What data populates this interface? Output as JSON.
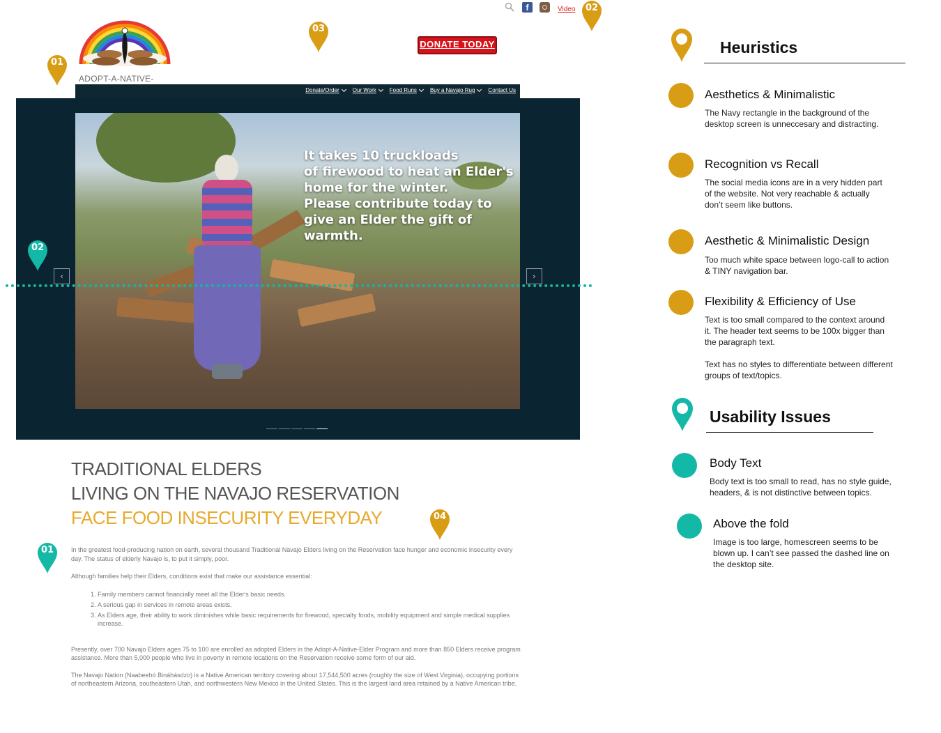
{
  "site": {
    "logo_caption": "ADOPT-A-NATIVE-ELDER",
    "video_link": "Video",
    "donate_button": "DONATE TODAY",
    "top_icons": [
      "search-icon",
      "facebook-icon",
      "instagram-icon"
    ],
    "nav": [
      {
        "label": "Donate/Order"
      },
      {
        "label": "Our Work"
      },
      {
        "label": "Food Runs"
      },
      {
        "label": "Buy a Navajo Rug"
      },
      {
        "label": "Contact Us"
      }
    ],
    "hero_text": "It takes 10 truckloads\nof firewood to heat an Elder's\nhome for the winter.\nPlease contribute today to\ngive an Elder the gift of warmth.",
    "carousel_prev": "‹",
    "carousel_next": "›",
    "headline": [
      "TRADITIONAL ELDERS",
      "LIVING ON THE NAVAJO RESERVATION",
      "FACE FOOD INSECURITY EVERYDAY"
    ],
    "para1": "In the greatest food-producing nation on earth, several thousand Traditional Navajo Elders living on the Reservation face hunger and economic insecurity every day. The status of elderly Navajo is, to put it simply, poor.",
    "para2": "Although families help their Elders, conditions exist that make our assistance essential:",
    "list": [
      "Family members cannot financially meet all the Elder's basic needs.",
      "A serious gap in services in remote areas exists.",
      "As Elders age, their ability to work diminishes while basic requirements for firewood, specialty foods, mobility equipment and simple medical supplies increase."
    ],
    "para3": "Presently, over 700 Navajo Elders ages 75 to 100 are enrolled as adopted Elders in the Adopt-A-Native-Elder Program and more than 850 Elders receive program assistance. More than 5,000 people who live in poverty in remote locations on the Reservation receive some form of our aid.",
    "para4": "The Navajo Nation (Naabeehó Bináhásdzo) is a Native American territory covering about 17,544,500 acres (roughly the size of West Virginia), occupying portions of northeastern Arizona, southeastern Utah, and northwestern New Mexico in the United States. This is the largest land area retained by a Native American tribe."
  },
  "pins": {
    "gold": [
      "01",
      "02",
      "03",
      "04"
    ],
    "teal": [
      "02",
      "01"
    ]
  },
  "colors": {
    "gold": "#d89d14",
    "teal": "#14b8a6",
    "navy": "#0b2431",
    "donate_red": "#d4131a"
  },
  "heuristics": {
    "title": "Heuristics",
    "items": [
      {
        "title": "Aesthetics & Minimalistic",
        "desc": "The Navy rectangle in the background of the desktop screen is unneccesary and distracting."
      },
      {
        "title": "Recognition vs Recall",
        "desc": "The social media icons are in a very hidden part of the website. Not very reachable & actually don’t seem like buttons."
      },
      {
        "title": "Aesthetic & Minimalistic Design",
        "desc": "Too much white space between logo-call to action & TINY navigation bar."
      },
      {
        "title": "Flexibility & Efficiency of Use",
        "desc": "Text is too small compared to the context around it. The header text seems to be 100x bigger than the paragraph text.",
        "desc2": "Text has no styles to differentiate between different groups of text/topics."
      }
    ]
  },
  "usability": {
    "title": "Usability Issues",
    "items": [
      {
        "title": "Body Text",
        "desc": "Body text is too small to read, has no style guide, headers, & is not distinctive between topics."
      },
      {
        "title": "Above the fold",
        "desc": "Image is too large, homescreen seems to be blown up. I can’t see passed the dashed line on the desktop site."
      }
    ]
  }
}
